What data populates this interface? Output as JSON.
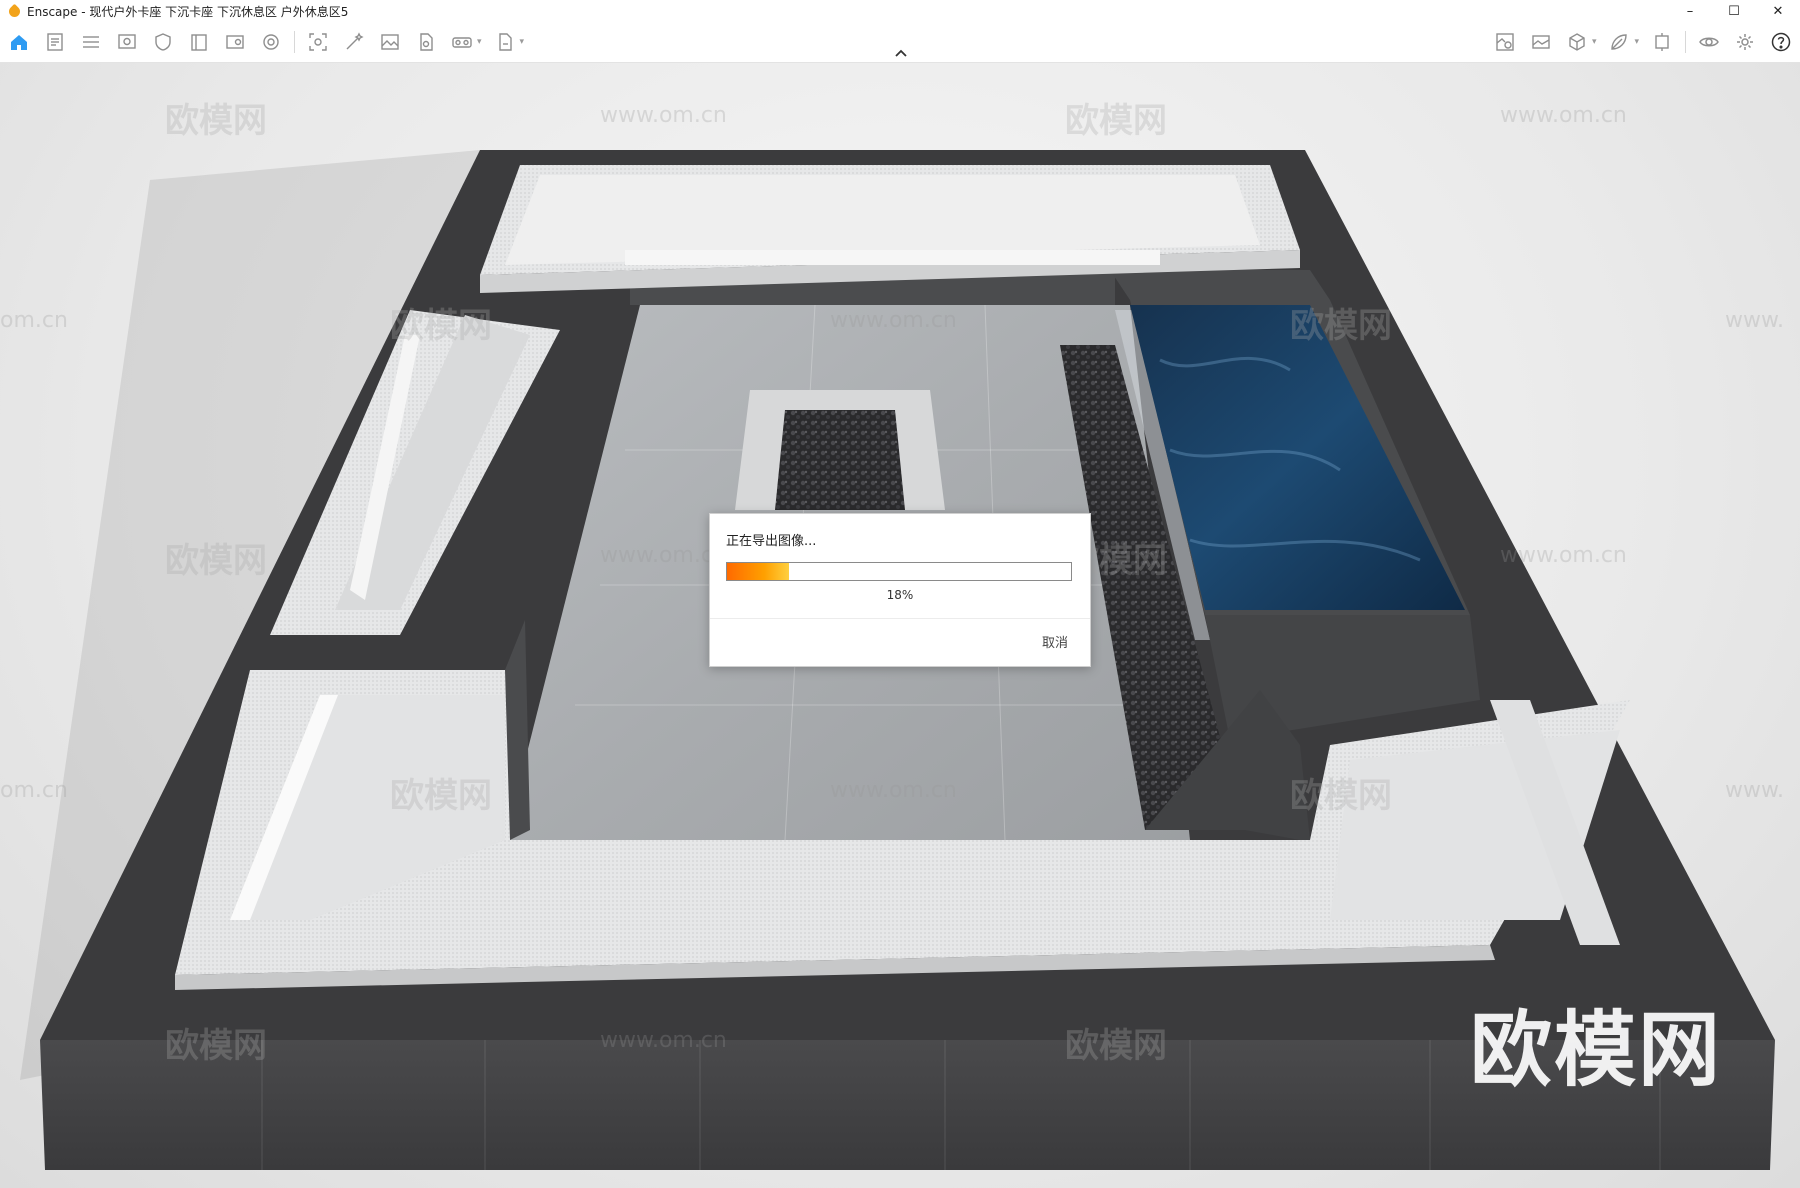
{
  "window": {
    "title": "Enscape - 现代户外卡座 下沉卡座 下沉休息区 户外休息区5",
    "controls": {
      "minimize": "–",
      "maximize": "☐",
      "close": "✕"
    }
  },
  "toolbar": {
    "left_icons": [
      "home-icon",
      "document-icon",
      "layers-icon",
      "preview-icon",
      "shield-icon",
      "book-icon",
      "settings-panel-icon",
      "target-icon",
      "capture-frame-icon",
      "magic-wand-icon",
      "image-icon",
      "object-edit-icon",
      "vr-headset-icon",
      "export-icon"
    ],
    "right_icons": [
      "asset-map-icon",
      "screenshot-gallery-icon",
      "cube-view-icon",
      "material-icon",
      "sun-icon",
      "eye-icon",
      "gear-icon",
      "help-icon"
    ],
    "accent_color": "#2e9bf2"
  },
  "watermarks": {
    "logo": "欧模网",
    "site": "www.om.cn",
    "site_partial_left": "om.cn",
    "site_partial_right": "www."
  },
  "dialog": {
    "message": "正在导出图像...",
    "progress_value": 0.18,
    "progress_label": "18%",
    "cancel_label": "取消"
  }
}
